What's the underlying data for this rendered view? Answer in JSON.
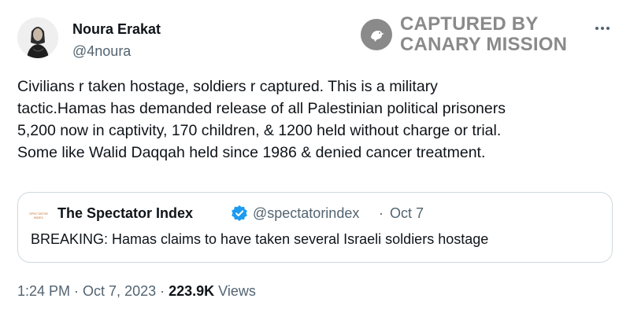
{
  "author": {
    "name": "Noura Erakat",
    "handle": "@4noura"
  },
  "watermark": {
    "line1": "CAPTURED BY",
    "line2": "CANARY MISSION",
    "icon": "canary-bird-icon"
  },
  "tweet": {
    "lines": [
      "Civilians r taken hostage, soldiers r captured. This is a military",
      "tactic.Hamas has demanded release of all Palestinian political prisoners",
      "5,200 now in captivity, 170 children, & 1200 held without charge or trial.",
      "Some like Walid Daqqah held since 1986 & denied cancer treatment."
    ]
  },
  "quote": {
    "name": "The Spectator Index",
    "handle": "@spectatorindex",
    "separator": "·",
    "date": "Oct 7",
    "text": "BREAKING: Hamas claims to have taken several Israeli soldiers hostage",
    "avatar_text": [
      "SPECTATOR",
      "INDEX"
    ],
    "verified_color": "#1d9bf0"
  },
  "meta": {
    "time": "1:24 PM",
    "separator": "·",
    "date": "Oct 7, 2023",
    "separator2": "·",
    "views_count": "223.9K",
    "views_label": "Views"
  },
  "colors": {
    "text": "#0f1419",
    "secondary": "#536471",
    "border": "#cfd9de",
    "watermark": "#8a8a8a"
  }
}
